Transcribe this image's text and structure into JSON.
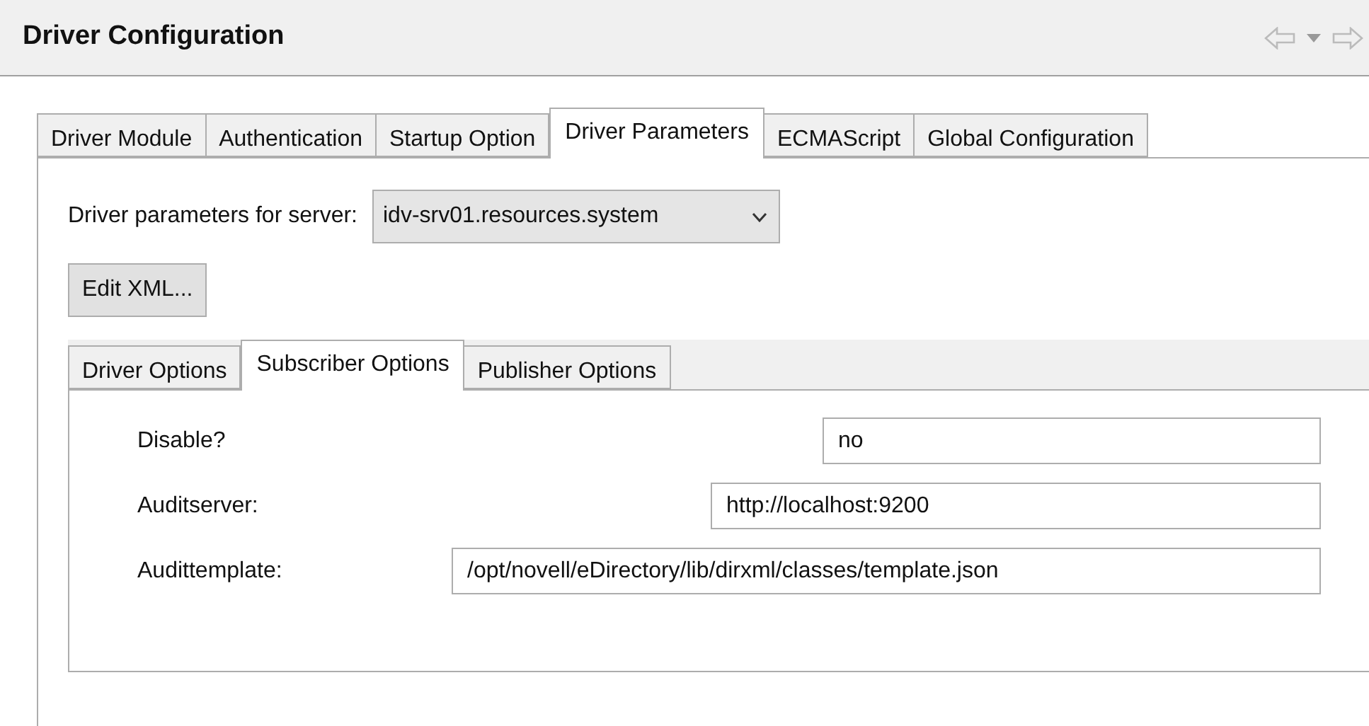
{
  "header": {
    "title": "Driver Configuration"
  },
  "tabs": [
    {
      "label": "Driver Module",
      "selected": false
    },
    {
      "label": "Authentication",
      "selected": false
    },
    {
      "label": "Startup Option",
      "selected": false
    },
    {
      "label": "Driver Parameters",
      "selected": true
    },
    {
      "label": "ECMAScript",
      "selected": false
    },
    {
      "label": "Global Configuration",
      "selected": false
    }
  ],
  "server": {
    "label": "Driver parameters for server:",
    "value": "idv-srv01.resources.system"
  },
  "edit_button": "Edit XML...",
  "subtabs": [
    {
      "label": "Driver Options",
      "selected": false
    },
    {
      "label": "Subscriber Options",
      "selected": true
    },
    {
      "label": "Publisher Options",
      "selected": false
    }
  ],
  "fields": [
    {
      "label": "Disable?",
      "value": "no"
    },
    {
      "label": "Auditserver:",
      "value": "http://localhost:9200"
    },
    {
      "label": "Audittemplate:",
      "value": "/opt/novell/eDirectory/lib/dirxml/classes/template.json"
    }
  ]
}
